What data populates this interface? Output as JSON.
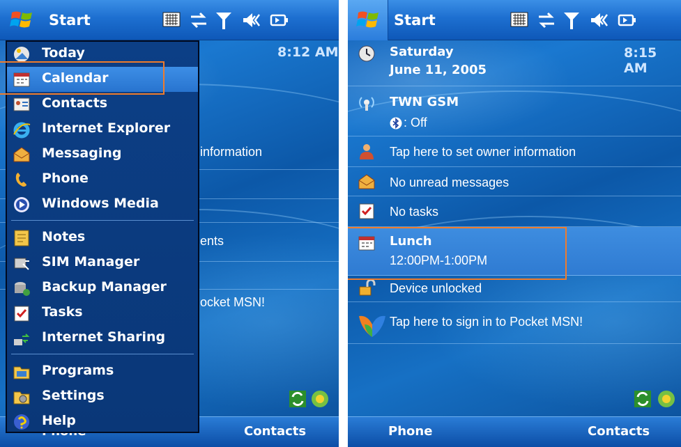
{
  "left": {
    "start_label": "Start",
    "clock": "8:12 AM",
    "menu_items": [
      {
        "label": "Today"
      },
      {
        "label": "Calendar"
      },
      {
        "label": "Contacts"
      },
      {
        "label": "Internet Explorer"
      },
      {
        "label": "Messaging"
      },
      {
        "label": "Phone"
      },
      {
        "label": "Windows Media"
      },
      {
        "label": "Notes"
      },
      {
        "label": "SIM Manager"
      },
      {
        "label": "Backup Manager"
      },
      {
        "label": "Tasks"
      },
      {
        "label": "Internet Sharing"
      },
      {
        "label": "Programs"
      },
      {
        "label": "Settings"
      },
      {
        "label": "Help"
      }
    ],
    "peek_texts": [
      "information",
      "ents",
      "ocket MSN!"
    ],
    "softkeys": {
      "left": "Phone",
      "right": "Contacts"
    }
  },
  "right": {
    "start_label": "Start",
    "date_day": "Saturday",
    "date_full": "June 11, 2005",
    "clock": "8:15 AM",
    "network": "TWN GSM",
    "bluetooth": ": Off",
    "owner": "Tap here to set owner information",
    "messages": "No unread messages",
    "tasks": "No tasks",
    "appointment_title": "Lunch",
    "appointment_time": "12:00PM-1:00PM",
    "device": "Device unlocked",
    "msn": "Tap here to sign in to Pocket MSN!",
    "softkeys": {
      "left": "Phone",
      "right": "Contacts"
    }
  },
  "colors": {
    "highlight": "#ef7c2c",
    "accent": "#1a6fd0"
  }
}
